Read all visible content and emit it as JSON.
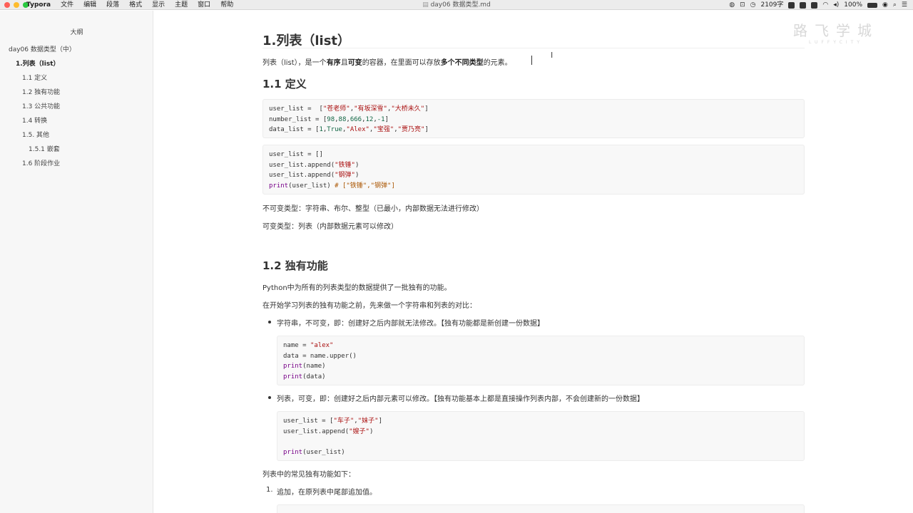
{
  "menubar": {
    "app_name": "Typora",
    "menus": [
      "文件",
      "编辑",
      "段落",
      "格式",
      "显示",
      "主题",
      "窗口",
      "帮助"
    ],
    "window_title": "day06 数据类型.md",
    "word_count": "2109字",
    "battery": "100%",
    "traffic_colors": [
      "#fe5f57",
      "#febc2e",
      "#28c840"
    ]
  },
  "sidebar": {
    "title": "大纲",
    "items": [
      {
        "label": "day06 数据类型（中）",
        "level": 1
      },
      {
        "label": "1.列表（list）",
        "level": 2,
        "active": true
      },
      {
        "label": "1.1 定义",
        "level": 3
      },
      {
        "label": "1.2 独有功能",
        "level": 3
      },
      {
        "label": "1.3 公共功能",
        "level": 3
      },
      {
        "label": "1.4 转换",
        "level": 3
      },
      {
        "label": "1.5. 其他",
        "level": 3
      },
      {
        "label": "1.5.1 嵌套",
        "level": 4
      },
      {
        "label": "1.6 阶段作业",
        "level": 3
      }
    ]
  },
  "watermark": {
    "title": "路飞学城",
    "subtitle": "LUFFYCITY"
  },
  "doc": {
    "h1": "1.列表（list）",
    "intro": {
      "t1": "列表（list），是一个",
      "b1": "有序",
      "t2": "且",
      "b2": "可变",
      "t3": "的容器，在里面可以存放",
      "b3": "多个不同类型",
      "t4": "的元素。"
    },
    "h2_define": "1.1 定义",
    "code1": [
      [
        {
          "t": "user_list =  [",
          "c": ""
        },
        {
          "t": "\"苍老师\"",
          "c": "s"
        },
        {
          "t": ",",
          "c": ""
        },
        {
          "t": "\"有坂深雪\"",
          "c": "s"
        },
        {
          "t": ",",
          "c": ""
        },
        {
          "t": "\"大桥未久\"",
          "c": "s"
        },
        {
          "t": "]",
          "c": ""
        }
      ],
      [
        {
          "t": "number_list = [",
          "c": ""
        },
        {
          "t": "98",
          "c": "n"
        },
        {
          "t": ",",
          "c": ""
        },
        {
          "t": "88",
          "c": "n"
        },
        {
          "t": ",",
          "c": ""
        },
        {
          "t": "666",
          "c": "n"
        },
        {
          "t": ",",
          "c": ""
        },
        {
          "t": "12",
          "c": "n"
        },
        {
          "t": ",",
          "c": ""
        },
        {
          "t": "-1",
          "c": "n"
        },
        {
          "t": "]",
          "c": ""
        }
      ],
      [
        {
          "t": "data_list = [",
          "c": ""
        },
        {
          "t": "1",
          "c": "n"
        },
        {
          "t": ",",
          "c": ""
        },
        {
          "t": "True",
          "c": "n"
        },
        {
          "t": ",",
          "c": ""
        },
        {
          "t": "\"Alex\"",
          "c": "s"
        },
        {
          "t": ",",
          "c": ""
        },
        {
          "t": "\"宝强\"",
          "c": "s"
        },
        {
          "t": ",",
          "c": ""
        },
        {
          "t": "\"贾乃亮\"",
          "c": "s"
        },
        {
          "t": "]",
          "c": ""
        }
      ]
    ],
    "code2": [
      [
        {
          "t": "user_list = []",
          "c": ""
        }
      ],
      [
        {
          "t": "user_list.append(",
          "c": ""
        },
        {
          "t": "\"铁锤\"",
          "c": "s"
        },
        {
          "t": ")",
          "c": ""
        }
      ],
      [
        {
          "t": "user_list.append(",
          "c": ""
        },
        {
          "t": "\"钢弹\"",
          "c": "s"
        },
        {
          "t": ")",
          "c": ""
        }
      ],
      [
        {
          "t": "print",
          "c": "kw"
        },
        {
          "t": "(user_list) ",
          "c": ""
        },
        {
          "t": "# [\"铁锤\",\"钢弹\"]",
          "c": "cm"
        }
      ]
    ],
    "immutable": "不可变类型：字符串、布尔、整型（已最小，内部数据无法进行修改）",
    "mutable": "可变类型：列表（内部数据元素可以修改）",
    "h2_unique": "1.2 独有功能",
    "p_unique1": "Python中为所有的列表类型的数据提供了一批独有的功能。",
    "p_unique2": "在开始学习列表的独有功能之前，先来做一个字符串和列表的对比：",
    "bullet1": "字符串，不可变，即：创建好之后内部就无法修改。【独有功能都是新创建一份数据】",
    "code3": [
      [
        {
          "t": "name = ",
          "c": ""
        },
        {
          "t": "\"alex\"",
          "c": "s"
        }
      ],
      [
        {
          "t": "data = name.upper()",
          "c": ""
        }
      ],
      [
        {
          "t": "print",
          "c": "kw"
        },
        {
          "t": "(name)",
          "c": ""
        }
      ],
      [
        {
          "t": "print",
          "c": "kw"
        },
        {
          "t": "(data)",
          "c": ""
        }
      ]
    ],
    "bullet2": "列表，可变，即：创建好之后内部元素可以修改。【独有功能基本上都是直接操作列表内部，不会创建新的一份数据】",
    "code4": [
      [
        {
          "t": "user_list = [",
          "c": ""
        },
        {
          "t": "\"车子\"",
          "c": "s"
        },
        {
          "t": ",",
          "c": ""
        },
        {
          "t": "\"妹子\"",
          "c": "s"
        },
        {
          "t": "]",
          "c": ""
        }
      ],
      [
        {
          "t": "user_list.append(",
          "c": ""
        },
        {
          "t": "\"嫂子\"",
          "c": "s"
        },
        {
          "t": ")",
          "c": ""
        }
      ],
      [
        {
          "t": "",
          "c": ""
        }
      ],
      [
        {
          "t": "print",
          "c": "kw"
        },
        {
          "t": "(user_list)",
          "c": ""
        }
      ]
    ],
    "p_common": "列表中的常见独有功能如下：",
    "ol1_num": "1.",
    "ol1": "追加，在原列表中尾部追加值。"
  }
}
